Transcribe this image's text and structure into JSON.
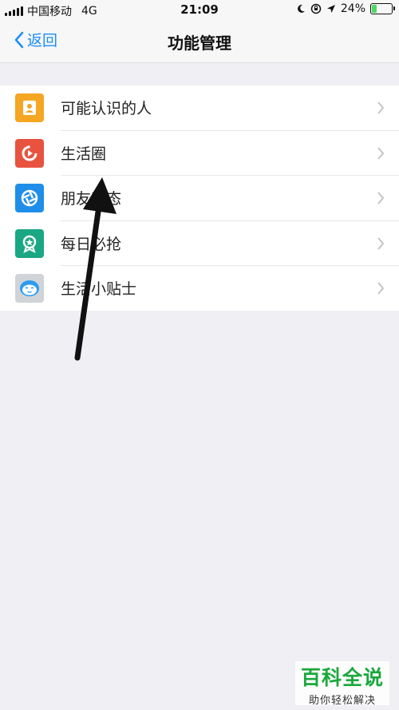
{
  "status_bar": {
    "carrier": "中国移动",
    "network": "4G",
    "time": "21:09",
    "battery_percent": "24%",
    "battery_level": 0.24
  },
  "nav": {
    "back_label": "返回",
    "title": "功能管理"
  },
  "colors": {
    "accent": "#1a8ef5",
    "battery": "#4cd964"
  },
  "list": {
    "items": [
      {
        "label": "可能认识的人",
        "icon": "contact-book-icon",
        "color": "#f5a623"
      },
      {
        "label": "生活圈",
        "icon": "life-circle-icon",
        "color": "#e8533f"
      },
      {
        "label": "朋友动态",
        "icon": "aperture-icon",
        "color": "#1f8ee8"
      },
      {
        "label": "每日必抢",
        "icon": "star-badge-icon",
        "color": "#1aa884"
      },
      {
        "label": "生活小贴士",
        "icon": "smiley-face-icon",
        "color": "#d0d4d8"
      }
    ]
  },
  "watermark": {
    "title": "百科全说",
    "subtitle": "助你轻松解决"
  }
}
